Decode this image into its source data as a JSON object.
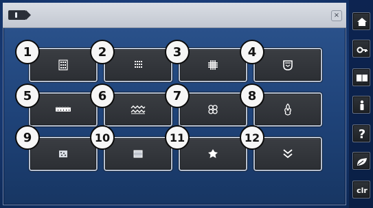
{
  "screen": {
    "colors": {
      "background": "#183a74",
      "tile": "#2f3237",
      "tile_border": "#b7c0cf",
      "titlebar": "#c9ced7",
      "icon": "#ffffff",
      "number_badge": "#f6f6f6"
    }
  },
  "dialog": {
    "title_icon": "pattern-tag-icon",
    "close_label": "×",
    "tiles": [
      {
        "number": "1",
        "icon": "stitch-grid-small-icon"
      },
      {
        "number": "2",
        "icon": "stitch-grid-dots-icon"
      },
      {
        "number": "3",
        "icon": "stitch-hash-icon"
      },
      {
        "number": "4",
        "icon": "shield-stitch-icon"
      },
      {
        "number": "5",
        "icon": "wave-border-icon"
      },
      {
        "number": "6",
        "icon": "zigzag-border-icon"
      },
      {
        "number": "7",
        "icon": "lace-pattern-icon"
      },
      {
        "number": "8",
        "icon": "ornament-figure-icon"
      },
      {
        "number": "9",
        "icon": "stipple-patch-icon"
      },
      {
        "number": "10",
        "icon": "quilt-square-icon"
      },
      {
        "number": "11",
        "icon": "star-leaf-icon"
      },
      {
        "number": "12",
        "icon": "double-chevron-icon"
      }
    ]
  },
  "side_panel": {
    "buttons": [
      {
        "name": "home",
        "icon": "home-icon"
      },
      {
        "name": "settings",
        "icon": "key-icon"
      },
      {
        "name": "manual",
        "icon": "book-icon"
      },
      {
        "name": "info",
        "icon": "info-icon"
      },
      {
        "name": "help",
        "label": "?",
        "icon": "help-icon"
      },
      {
        "name": "eco",
        "icon": "eco-icon"
      },
      {
        "name": "clear",
        "label": "clr"
      }
    ]
  }
}
